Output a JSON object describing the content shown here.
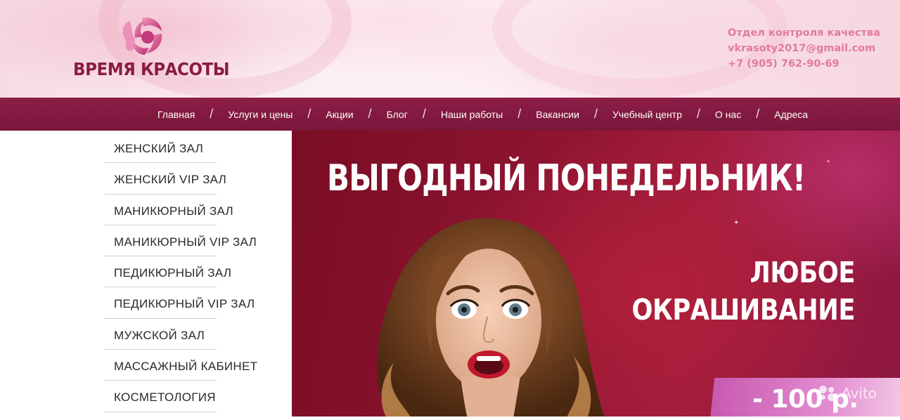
{
  "header": {
    "logo_text": "ВРЕМЯ КРАСОТЫ",
    "contacts": {
      "department": "Отдел контроля качества",
      "email": "vkrasoty2017@gmail.com",
      "phone": "+7 (905) 762-90-69"
    }
  },
  "nav": {
    "items": [
      {
        "label": "Главная"
      },
      {
        "label": "Услуги и цены"
      },
      {
        "label": "Акции"
      },
      {
        "label": "Блог"
      },
      {
        "label": "Наши работы"
      },
      {
        "label": "Вакансии"
      },
      {
        "label": "Учебный центр"
      },
      {
        "label": "О нас"
      },
      {
        "label": "Адреса"
      }
    ],
    "separator": "/"
  },
  "sidebar": {
    "items": [
      {
        "label": "ЖЕНСКИЙ ЗАЛ"
      },
      {
        "label": "ЖЕНСКИЙ VIP ЗАЛ"
      },
      {
        "label": "МАНИКЮРНЫЙ ЗАЛ"
      },
      {
        "label": "МАНИКЮРНЫЙ VIP ЗАЛ"
      },
      {
        "label": "ПЕДИКЮРНЫЙ ЗАЛ"
      },
      {
        "label": "ПЕДИКЮРНЫЙ VIP ЗАЛ"
      },
      {
        "label": "МУЖСКОЙ ЗАЛ"
      },
      {
        "label": "МАССАЖНЫЙ КАБИНЕТ"
      },
      {
        "label": "КОСМЕТОЛОГИЯ"
      }
    ]
  },
  "banner": {
    "title": "ВЫГОДНЫЙ ПОНЕДЕЛЬНИК!",
    "subtitle_line1": "ЛЮБОЕ",
    "subtitle_line2": "ОКРАШИВАНИЕ",
    "price": "- 100 р."
  },
  "watermark": {
    "text": "Avito",
    "icon": "avito-logo-icon"
  },
  "colors": {
    "nav_bg": "#8c1e46",
    "logo_text": "#8a1b45",
    "contacts_text": "#e27aa0",
    "banner_bg": "#8e1430"
  }
}
